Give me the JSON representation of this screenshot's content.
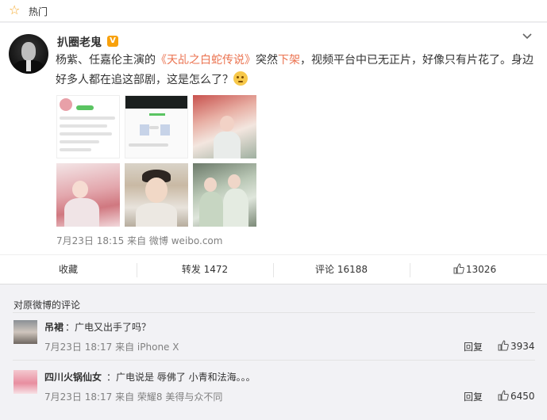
{
  "header": {
    "title": "热门",
    "icon": "star-outline-icon"
  },
  "post": {
    "username": "扒圈老鬼",
    "badge": "V",
    "text_before": "杨紫、任嘉伦主演的",
    "link1": "《天乩之白蛇传说》",
    "text_mid": "突然",
    "link2": "下架",
    "text_after": "，视频平台中已无正片，好像只有片花了。身边好多人都在追这部剧，这是怎么了？",
    "timestamp": "7月23日 18:15 来自 微博 weibo.com",
    "actions": {
      "favorite": "收藏",
      "repost": "转发 1472",
      "comment": "评论 16188",
      "like": "13026"
    }
  },
  "comments_section": {
    "title": "对原微博的评论",
    "comments": [
      {
        "name": "吊裙",
        "text": "：广电又出手了吗？",
        "meta": "7月23日 18:17 来自 iPhone X",
        "reply": "回复",
        "likes": "3934"
      },
      {
        "name": "四川火锅仙女",
        "text": "：广电说是 辱佛了 小青和法海。。。",
        "meta": "7月23日 18:17 来自 荣耀8 美得与众不同",
        "reply": "回复",
        "likes": "6450"
      }
    ]
  },
  "colors": {
    "link": "#eb7350",
    "badge": "#f8a10c",
    "meta": "#808080"
  }
}
